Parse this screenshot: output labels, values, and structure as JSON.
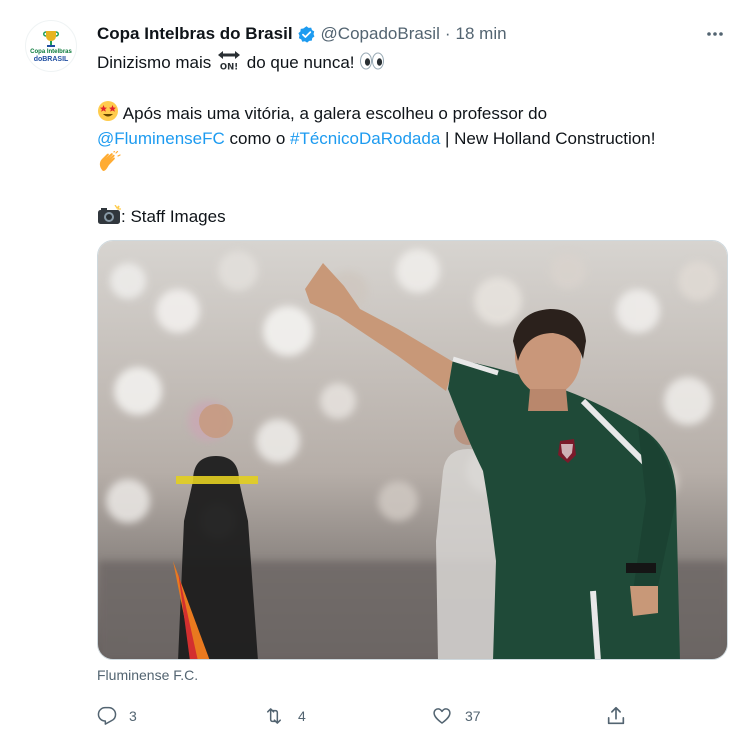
{
  "account": {
    "name": "Copa Intelbras do Brasil",
    "handle": "@CopadoBrasil",
    "separator": "·",
    "time": "18 min",
    "avatar_text_top": "Copa Intelbras",
    "avatar_text_mid": "do",
    "avatar_text_bottom": "BRASIL"
  },
  "tweet": {
    "line1_text_a": "Dinizismo mais",
    "line1_on": "ON!",
    "line1_text_b": "do que nunca!",
    "line2_text": "Após mais uma vitória, a galera escolheu o professor do",
    "mention": "@FluminenseFC",
    "line3_mid": "como o",
    "hashtag": "#TécnicoDaRodada",
    "line3_end": "| New Holland Construction!",
    "photo_credit": ": Staff Images"
  },
  "media": {
    "caption": "Fluminense F.C."
  },
  "actions": {
    "replies": "3",
    "retweets": "4",
    "likes": "37"
  },
  "colors": {
    "link": "#1d9bf0",
    "secondary": "#536471",
    "verified": "#1d9bf0",
    "jersey_green": "#1f4a38"
  },
  "icons": {
    "verified": "verified-badge-icon",
    "more": "more-icon",
    "reply": "reply-icon",
    "retweet": "retweet-icon",
    "like": "like-icon",
    "share": "share-icon"
  }
}
